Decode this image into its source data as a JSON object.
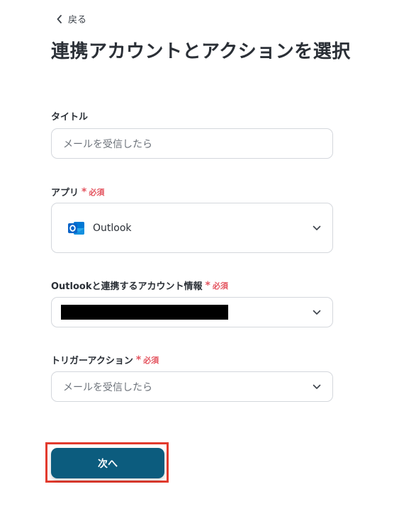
{
  "nav": {
    "back_label": "戻る"
  },
  "page": {
    "title": "連携アカウントとアクションを選択"
  },
  "required_label": "必須",
  "required_marker": "*",
  "fields": {
    "title": {
      "label": "タイトル",
      "value": "メールを受信したら"
    },
    "app": {
      "label": "アプリ",
      "value": "Outlook",
      "icon": "outlook-icon"
    },
    "account": {
      "label": "Outlookと連携するアカウント情報",
      "value": ""
    },
    "trigger": {
      "label": "トリガーアクション",
      "value": "メールを受信したら"
    }
  },
  "actions": {
    "next_label": "次へ"
  },
  "colors": {
    "primary_button": "#0c5c7e",
    "required": "#e4545f",
    "highlight_border": "#e23b2e",
    "outlook_blue": "#0a64c8"
  }
}
